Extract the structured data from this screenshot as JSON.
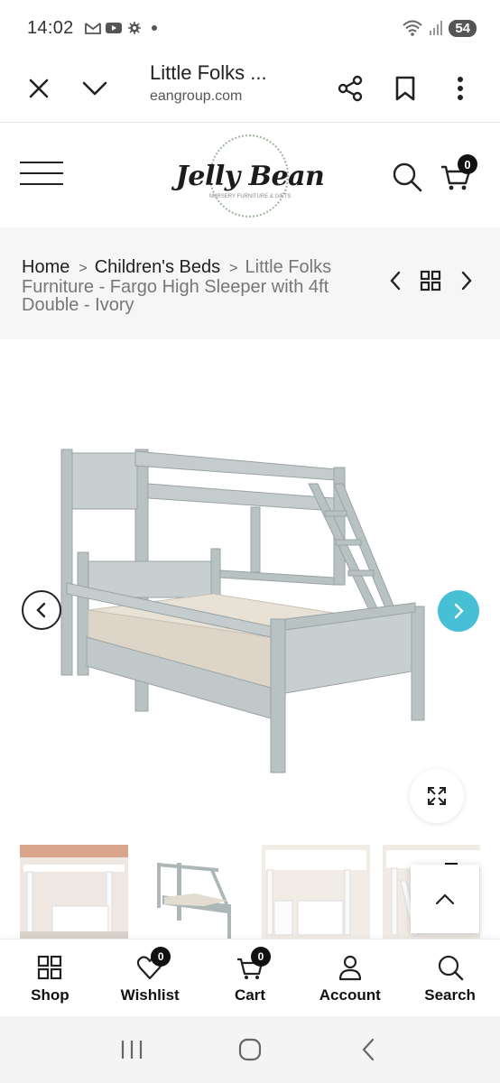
{
  "status_bar": {
    "time": "14:02",
    "battery": "54"
  },
  "browser": {
    "title": "Little Folks ...",
    "url": "eangroup.com"
  },
  "site": {
    "logo_text": "Jelly Bean",
    "logo_subtext": "NURSERY FURNITURE & GIFTS",
    "cart_count": "0"
  },
  "breadcrumb": {
    "items": [
      "Home",
      "Children's Beds"
    ],
    "current": "Little Folks Furniture - Fargo High Sleeper with 4ft Double - Ivory"
  },
  "bottom_nav": {
    "items": [
      {
        "label": "Shop",
        "icon": "grid-icon"
      },
      {
        "label": "Wishlist",
        "icon": "heart-icon",
        "badge": "0"
      },
      {
        "label": "Cart",
        "icon": "cart-icon",
        "badge": "0"
      },
      {
        "label": "Account",
        "icon": "user-icon"
      },
      {
        "label": "Search",
        "icon": "search-icon"
      }
    ]
  },
  "colors": {
    "accent": "#47c0d6",
    "badge": "#111111",
    "crumb_band": "#f6f6f6"
  }
}
